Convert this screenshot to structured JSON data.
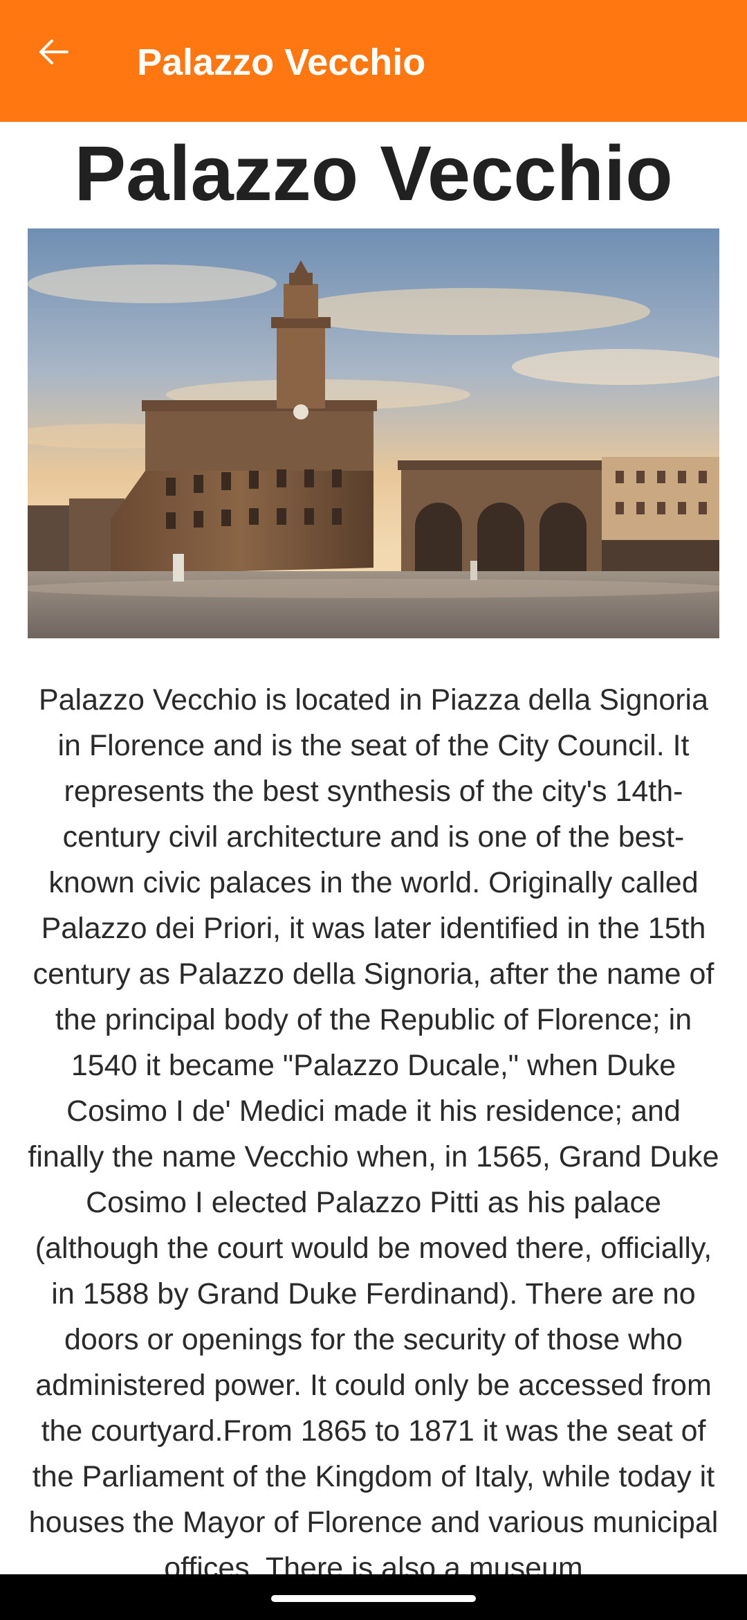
{
  "appbar": {
    "title": "Palazzo Vecchio",
    "back_icon": "arrow-left-icon",
    "background_color": "#ff7711"
  },
  "page": {
    "title": "Palazzo Vecchio",
    "image_subject": "Palazzo Vecchio in Piazza della Signoria at sunset",
    "description": "Palazzo Vecchio is located in Piazza della Signoria in Florence and is the seat of the City Council. It represents the best synthesis of the city's 14th-century civil architecture and is one of the best-known civic palaces in the world. Originally called Palazzo dei Priori, it was later identified in the 15th century as Palazzo della Signoria, after the name of the principal body of the Republic of Florence; in 1540 it became \"Palazzo Ducale,\" when Duke Cosimo I de' Medici made it his residence; and finally the name Vecchio when, in 1565, Grand Duke Cosimo I elected Palazzo Pitti as his palace (although the court would be moved there, officially, in 1588 by Grand Duke Ferdinand). There are no doors or openings for the security of those who administered power. It could only be accessed from the courtyard.From 1865 to 1871 it was the seat of the Parliament of the Kingdom of Italy, while today it houses the Mayor of Florence and various municipal offices. There is also a museum"
  }
}
